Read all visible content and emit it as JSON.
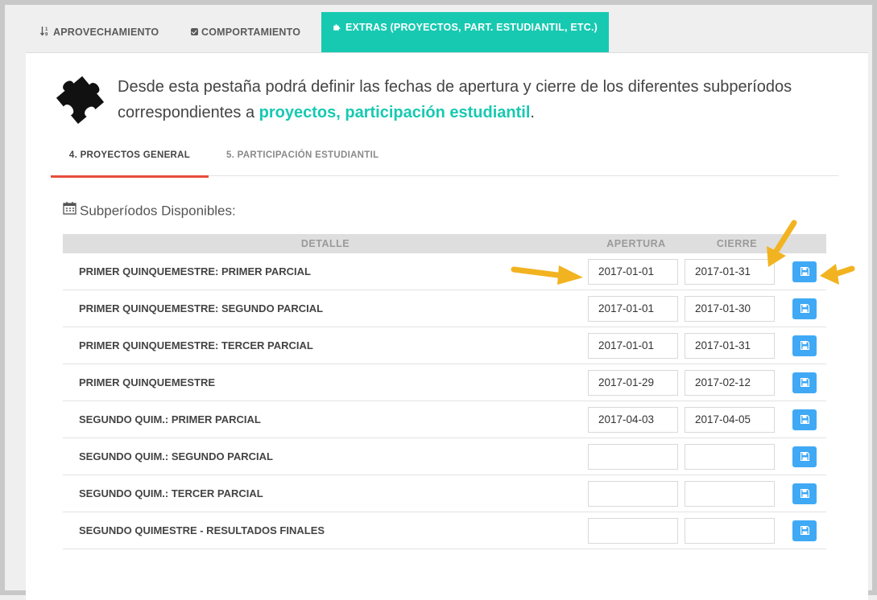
{
  "top_tabs": [
    {
      "icon": "sort-numeric-icon",
      "label": "APROVECHAMIENTO"
    },
    {
      "icon": "check-square-icon",
      "label": "COMPORTAMIENTO"
    },
    {
      "icon": "puzzle-piece-icon",
      "label": "EXTRAS (PROYECTOS, PART. ESTUDIANTIL, ETC.)",
      "active": true
    }
  ],
  "intro": {
    "text": "Desde esta pestaña podrá definir las fechas de apertura y cierre de los diferentes subperíodos correspondientes a ",
    "highlight": "proyectos, participación estudiantil",
    "end": "."
  },
  "sub_tabs": [
    {
      "label": "4. PROYECTOS GENERAL",
      "active": true
    },
    {
      "label": "5. PARTICIPACIÓN ESTUDIANTIL"
    }
  ],
  "section_title": "Subperíodos Disponibles:",
  "table": {
    "headers": {
      "detalle": "DETALLE",
      "apertura": "APERTURA",
      "cierre": "CIERRE"
    },
    "rows": [
      {
        "detalle": "PRIMER QUINQUEMESTRE: PRIMER PARCIAL",
        "apertura": "2017-01-01",
        "cierre": "2017-01-31"
      },
      {
        "detalle": "PRIMER QUINQUEMESTRE: SEGUNDO PARCIAL",
        "apertura": "2017-01-01",
        "cierre": "2017-01-30"
      },
      {
        "detalle": "PRIMER QUINQUEMESTRE: TERCER PARCIAL",
        "apertura": "2017-01-01",
        "cierre": "2017-01-31"
      },
      {
        "detalle": "PRIMER QUINQUEMESTRE",
        "apertura": "2017-01-29",
        "cierre": "2017-02-12"
      },
      {
        "detalle": "SEGUNDO QUIM.: PRIMER PARCIAL",
        "apertura": "2017-04-03",
        "cierre": "2017-04-05"
      },
      {
        "detalle": "SEGUNDO QUIM.: SEGUNDO PARCIAL",
        "apertura": "",
        "cierre": ""
      },
      {
        "detalle": "SEGUNDO QUIM.: TERCER PARCIAL",
        "apertura": "",
        "cierre": ""
      },
      {
        "detalle": "SEGUNDO QUIMESTRE - RESULTADOS FINALES",
        "apertura": "",
        "cierre": ""
      }
    ]
  },
  "colors": {
    "accent": "#17c9b1",
    "save_button": "#3fa9f5",
    "active_subtab": "#e74c3c",
    "annotation_arrow": "#f2b320"
  }
}
